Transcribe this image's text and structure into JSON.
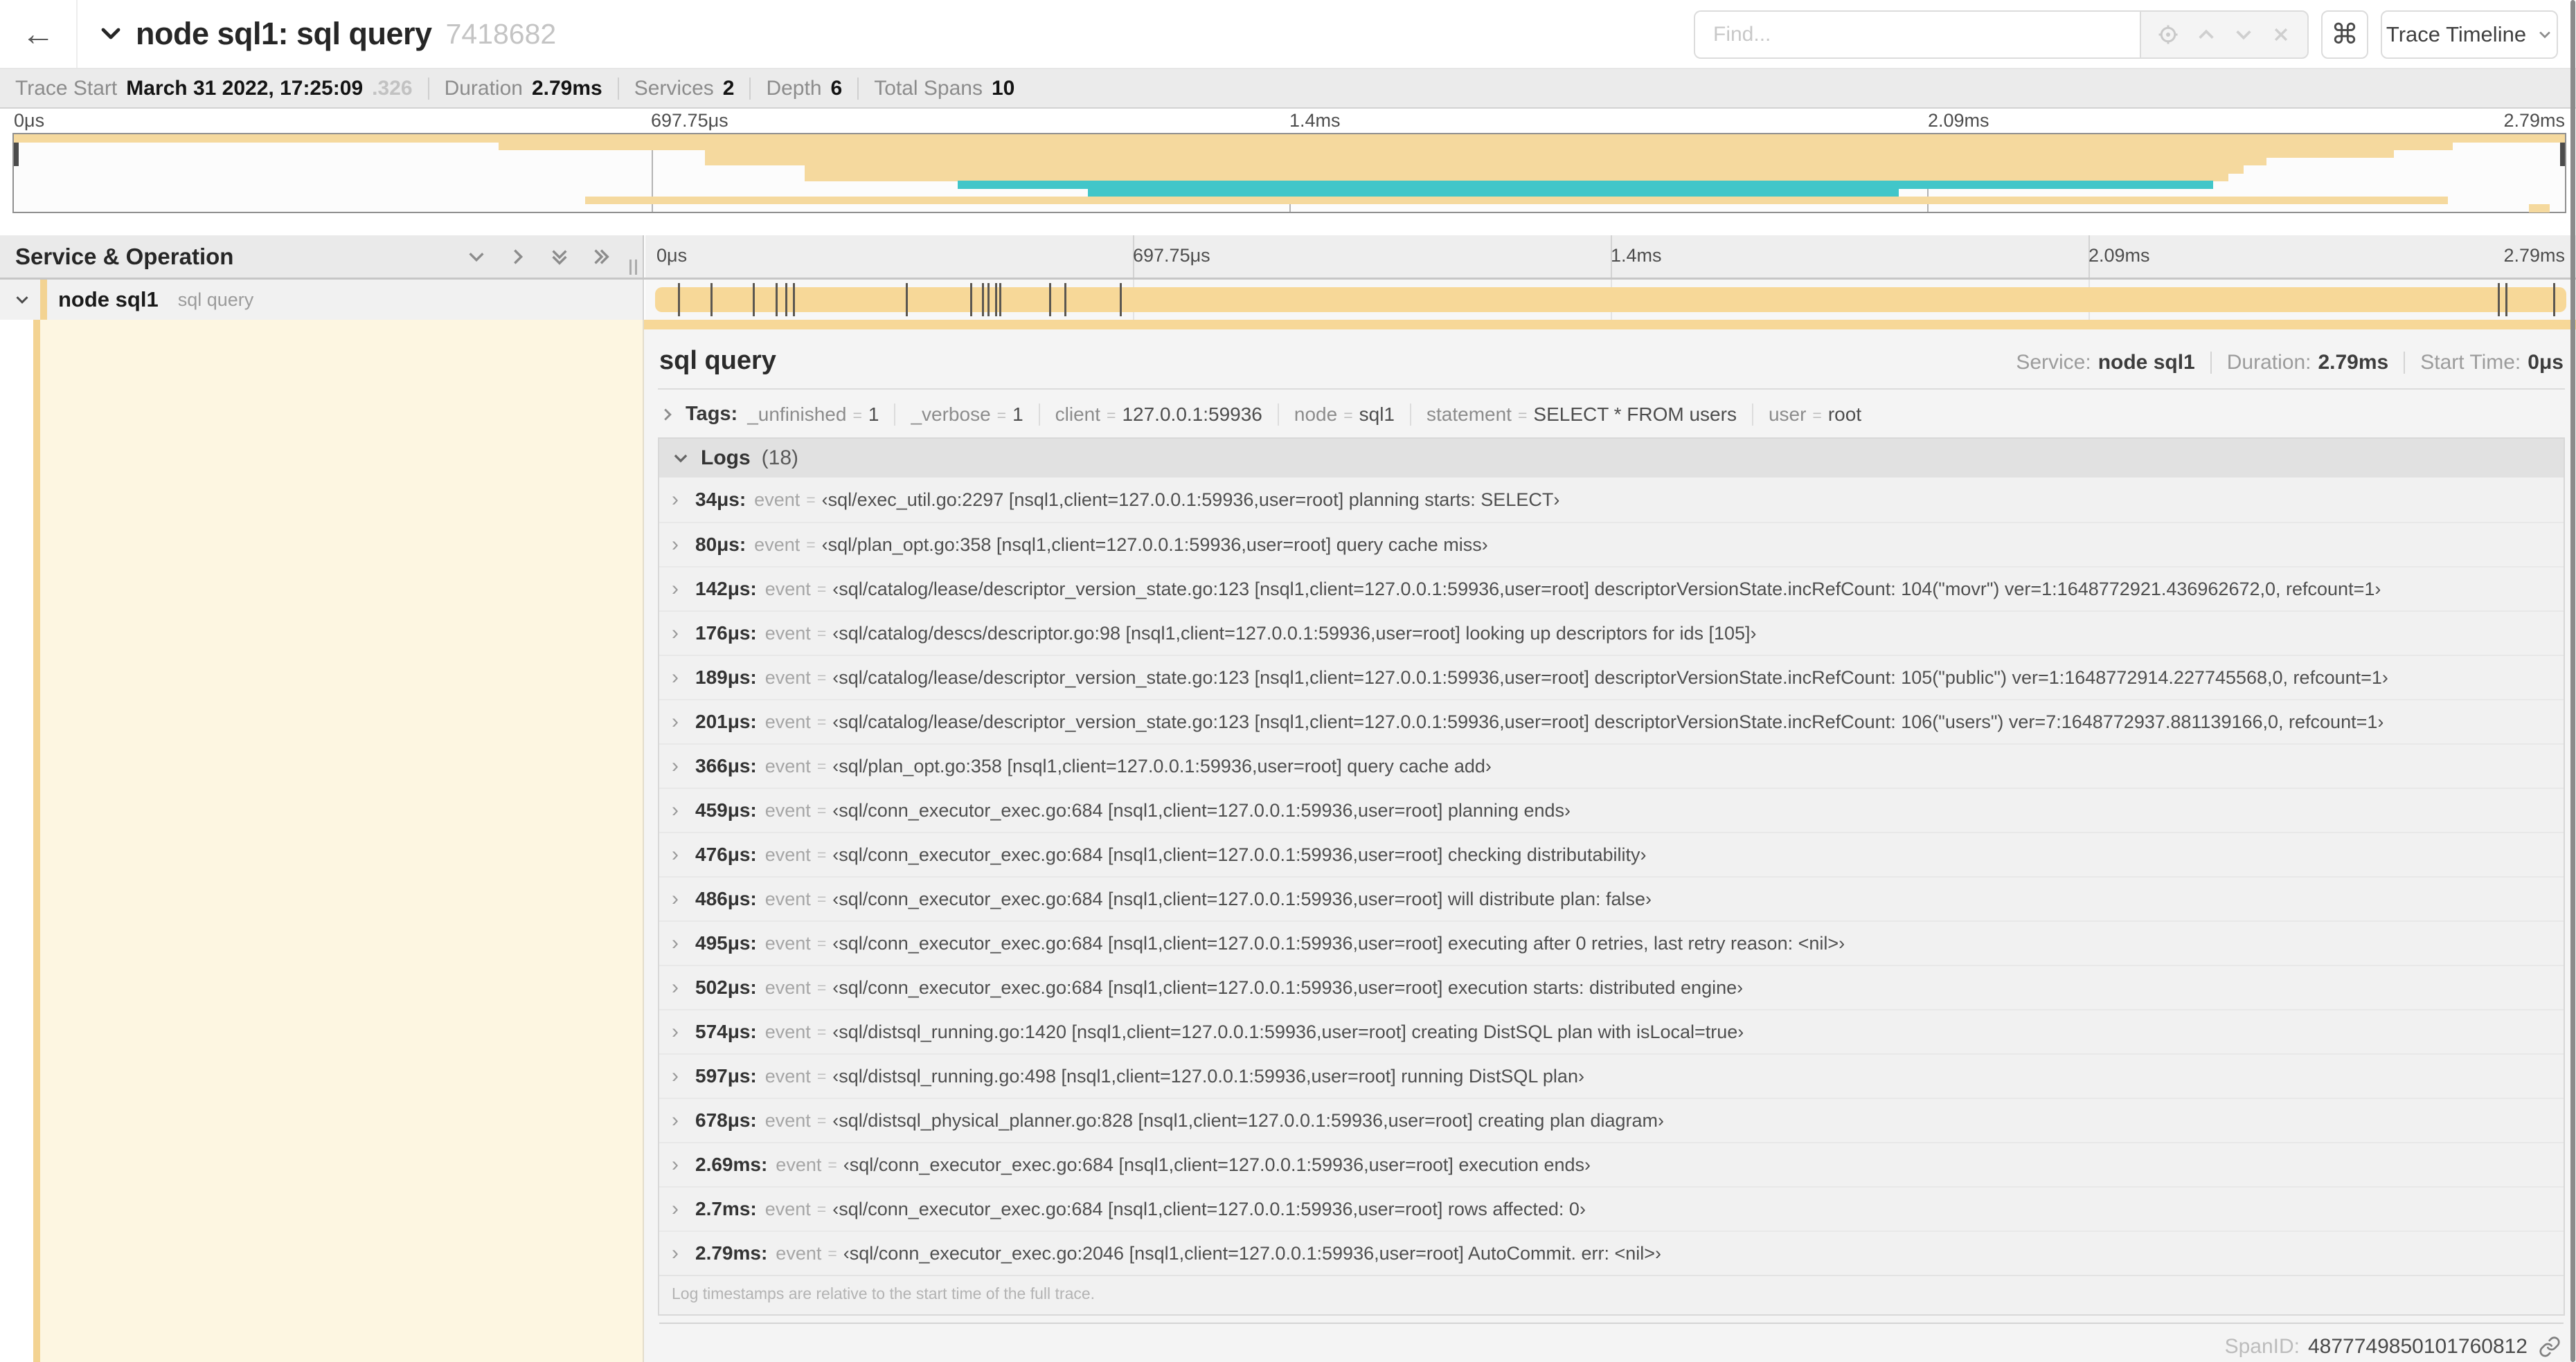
{
  "header": {
    "back_glyph": "←",
    "title": "node sql1: sql query",
    "trace_id": "7418682",
    "find_placeholder": "Find...",
    "shortcut_glyph": "⌘",
    "view_label": "Trace Timeline"
  },
  "summary": {
    "items": [
      {
        "label": "Trace Start",
        "value": "March 31 2022, 17:25:09",
        "extra": ".326"
      },
      {
        "label": "Duration",
        "value": "2.79ms"
      },
      {
        "label": "Services",
        "value": "2"
      },
      {
        "label": "Depth",
        "value": "6"
      },
      {
        "label": "Total Spans",
        "value": "10"
      }
    ]
  },
  "axis_ticks": [
    "0μs",
    "697.75μs",
    "1.4ms",
    "2.09ms",
    "2.79ms"
  ],
  "minimap": {
    "colors": {
      "tan": "#f5d99e",
      "teal": "#41c6c9"
    },
    "spans": [
      {
        "row": 0,
        "start": 0,
        "end": 100,
        "color": "tan"
      },
      {
        "row": 1,
        "start": 19,
        "end": 95.6,
        "color": "tan"
      },
      {
        "row": 2,
        "start": 27.1,
        "end": 93.3,
        "color": "tan"
      },
      {
        "row": 3,
        "start": 27.1,
        "end": 88.3,
        "color": "tan"
      },
      {
        "row": 4,
        "start": 31,
        "end": 87.4,
        "color": "tan"
      },
      {
        "row": 5,
        "start": 31,
        "end": 86.8,
        "color": "tan"
      },
      {
        "row": 6,
        "start": 37,
        "end": 86.2,
        "color": "teal"
      },
      {
        "row": 7,
        "start": 42.1,
        "end": 73.9,
        "color": "teal"
      },
      {
        "row": 8,
        "start": 22.4,
        "end": 95.4,
        "color": "tan"
      },
      {
        "row": 9,
        "start": 98.6,
        "end": 99.4,
        "color": "tan"
      }
    ]
  },
  "span_table": {
    "header_label": "Service & Operation",
    "row": {
      "service": "node sql1",
      "operation": "sql query"
    }
  },
  "span_bar": {
    "log_marks_pct": [
      1.2,
      2.9,
      5.1,
      6.3,
      6.8,
      7.2,
      13.1,
      16.5,
      17.1,
      17.4,
      17.8,
      18.0,
      20.6,
      21.4,
      24.3,
      96.4,
      96.8,
      99.3
    ]
  },
  "detail": {
    "title": "sql query",
    "meta": {
      "service_label": "Service:",
      "service_value": "node sql1",
      "duration_label": "Duration:",
      "duration_value": "2.79ms",
      "start_label": "Start Time:",
      "start_value": "0μs"
    },
    "tags": {
      "label": "Tags:",
      "items": [
        {
          "key": "_unfinished",
          "value": "1"
        },
        {
          "key": "_verbose",
          "value": "1"
        },
        {
          "key": "client",
          "value": "127.0.0.1:59936"
        },
        {
          "key": "node",
          "value": "sql1"
        },
        {
          "key": "statement",
          "value": "SELECT * FROM users"
        },
        {
          "key": "user",
          "value": "root"
        }
      ]
    },
    "logs": {
      "label": "Logs",
      "count": "(18)",
      "entries": [
        {
          "time": "34μs:",
          "field": "event",
          "value": "‹sql/exec_util.go:2297 [nsql1,client=127.0.0.1:59936,user=root] planning starts: SELECT›"
        },
        {
          "time": "80μs:",
          "field": "event",
          "value": "‹sql/plan_opt.go:358 [nsql1,client=127.0.0.1:59936,user=root] query cache miss›"
        },
        {
          "time": "142μs:",
          "field": "event",
          "value": "‹sql/catalog/lease/descriptor_version_state.go:123 [nsql1,client=127.0.0.1:59936,user=root] descriptorVersionState.incRefCount: 104(\"movr\") ver=1:1648772921.436962672,0, refcount=1›"
        },
        {
          "time": "176μs:",
          "field": "event",
          "value": "‹sql/catalog/descs/descriptor.go:98 [nsql1,client=127.0.0.1:59936,user=root] looking up descriptors for ids [105]›"
        },
        {
          "time": "189μs:",
          "field": "event",
          "value": "‹sql/catalog/lease/descriptor_version_state.go:123 [nsql1,client=127.0.0.1:59936,user=root] descriptorVersionState.incRefCount: 105(\"public\") ver=1:1648772914.227745568,0, refcount=1›"
        },
        {
          "time": "201μs:",
          "field": "event",
          "value": "‹sql/catalog/lease/descriptor_version_state.go:123 [nsql1,client=127.0.0.1:59936,user=root] descriptorVersionState.incRefCount: 106(\"users\") ver=7:1648772937.881139166,0, refcount=1›"
        },
        {
          "time": "366μs:",
          "field": "event",
          "value": "‹sql/plan_opt.go:358 [nsql1,client=127.0.0.1:59936,user=root] query cache add›"
        },
        {
          "time": "459μs:",
          "field": "event",
          "value": "‹sql/conn_executor_exec.go:684 [nsql1,client=127.0.0.1:59936,user=root] planning ends›"
        },
        {
          "time": "476μs:",
          "field": "event",
          "value": "‹sql/conn_executor_exec.go:684 [nsql1,client=127.0.0.1:59936,user=root] checking distributability›"
        },
        {
          "time": "486μs:",
          "field": "event",
          "value": "‹sql/conn_executor_exec.go:684 [nsql1,client=127.0.0.1:59936,user=root] will distribute plan: false›"
        },
        {
          "time": "495μs:",
          "field": "event",
          "value": "‹sql/conn_executor_exec.go:684 [nsql1,client=127.0.0.1:59936,user=root] executing after 0 retries, last retry reason: <nil>›"
        },
        {
          "time": "502μs:",
          "field": "event",
          "value": "‹sql/conn_executor_exec.go:684 [nsql1,client=127.0.0.1:59936,user=root] execution starts: distributed engine›"
        },
        {
          "time": "574μs:",
          "field": "event",
          "value": "‹sql/distsql_running.go:1420 [nsql1,client=127.0.0.1:59936,user=root] creating DistSQL plan with isLocal=true›"
        },
        {
          "time": "597μs:",
          "field": "event",
          "value": "‹sql/distsql_running.go:498 [nsql1,client=127.0.0.1:59936,user=root] running DistSQL plan›"
        },
        {
          "time": "678μs:",
          "field": "event",
          "value": "‹sql/distsql_physical_planner.go:828 [nsql1,client=127.0.0.1:59936,user=root] creating plan diagram›"
        },
        {
          "time": "2.69ms:",
          "field": "event",
          "value": "‹sql/conn_executor_exec.go:684 [nsql1,client=127.0.0.1:59936,user=root] execution ends›"
        },
        {
          "time": "2.7ms:",
          "field": "event",
          "value": "‹sql/conn_executor_exec.go:684 [nsql1,client=127.0.0.1:59936,user=root] rows affected: 0›"
        },
        {
          "time": "2.79ms:",
          "field": "event",
          "value": "‹sql/conn_executor_exec.go:2046 [nsql1,client=127.0.0.1:59936,user=root] AutoCommit. err: <nil>›"
        }
      ],
      "note": "Log timestamps are relative to the start time of the full trace."
    },
    "footer": {
      "span_id_label": "SpanID:",
      "span_id": "4877749850101760812"
    }
  }
}
